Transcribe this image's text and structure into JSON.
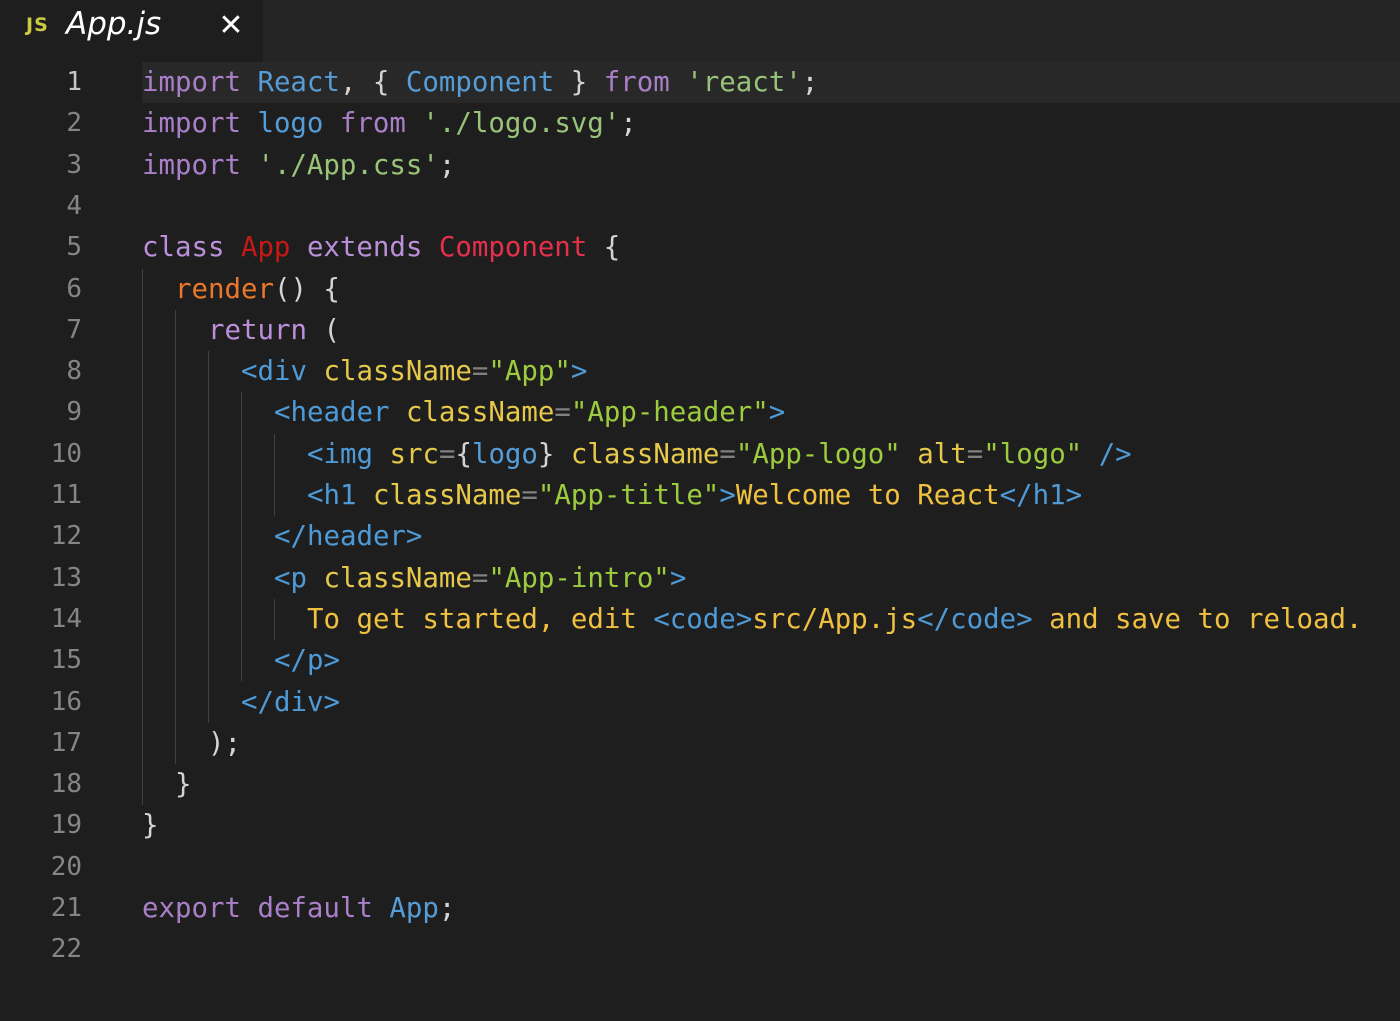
{
  "tab": {
    "icon_label": "JS",
    "icon": "js-file-icon",
    "title": "App.js",
    "close": "✕"
  },
  "editor": {
    "active_line": 1,
    "lines": [
      {
        "n": "1",
        "indent": 0,
        "tokens": [
          [
            "imp",
            "import"
          ],
          [
            "pun",
            " "
          ],
          [
            "id",
            "React"
          ],
          [
            "pun",
            ", { "
          ],
          [
            "id",
            "Component"
          ],
          [
            "pun",
            " } "
          ],
          [
            "imp",
            "from"
          ],
          [
            "pun",
            " "
          ],
          [
            "str",
            "'react'"
          ],
          [
            "pun",
            ";"
          ]
        ]
      },
      {
        "n": "2",
        "indent": 0,
        "tokens": [
          [
            "imp",
            "import"
          ],
          [
            "pun",
            " "
          ],
          [
            "id",
            "logo"
          ],
          [
            "pun",
            " "
          ],
          [
            "imp",
            "from"
          ],
          [
            "pun",
            " "
          ],
          [
            "str",
            "'./logo.svg'"
          ],
          [
            "pun",
            ";"
          ]
        ]
      },
      {
        "n": "3",
        "indent": 0,
        "tokens": [
          [
            "imp",
            "import"
          ],
          [
            "pun",
            " "
          ],
          [
            "str",
            "'./App.css'"
          ],
          [
            "pun",
            ";"
          ]
        ]
      },
      {
        "n": "4",
        "indent": 0,
        "tokens": []
      },
      {
        "n": "5",
        "indent": 0,
        "tokens": [
          [
            "cls",
            "class"
          ],
          [
            "pun",
            " "
          ],
          [
            "red",
            "App"
          ],
          [
            "pun",
            " "
          ],
          [
            "cls",
            "extends"
          ],
          [
            "pun",
            " "
          ],
          [
            "comp",
            "Component"
          ],
          [
            "pun",
            " {"
          ]
        ]
      },
      {
        "n": "6",
        "indent": 1,
        "tokens": [
          [
            "fn",
            "render"
          ],
          [
            "pun",
            "() {"
          ]
        ]
      },
      {
        "n": "7",
        "indent": 2,
        "tokens": [
          [
            "cls",
            "return"
          ],
          [
            "pun",
            " ("
          ]
        ]
      },
      {
        "n": "8",
        "indent": 3,
        "tokens": [
          [
            "tag",
            "<div"
          ],
          [
            "pun",
            " "
          ],
          [
            "attr",
            "className"
          ],
          [
            "eq",
            "="
          ],
          [
            "aval",
            "\"App\""
          ],
          [
            "tag",
            ">"
          ]
        ]
      },
      {
        "n": "9",
        "indent": 4,
        "tokens": [
          [
            "tag",
            "<header"
          ],
          [
            "pun",
            " "
          ],
          [
            "attr",
            "className"
          ],
          [
            "eq",
            "="
          ],
          [
            "aval",
            "\"App-header\""
          ],
          [
            "tag",
            ">"
          ]
        ]
      },
      {
        "n": "10",
        "indent": 5,
        "tokens": [
          [
            "tag",
            "<img"
          ],
          [
            "pun",
            " "
          ],
          [
            "attr",
            "src"
          ],
          [
            "eq",
            "="
          ],
          [
            "pun",
            "{"
          ],
          [
            "id",
            "logo"
          ],
          [
            "pun",
            "}"
          ],
          [
            "pun",
            " "
          ],
          [
            "attr",
            "className"
          ],
          [
            "eq",
            "="
          ],
          [
            "aval",
            "\"App-logo\""
          ],
          [
            "pun",
            " "
          ],
          [
            "attr",
            "alt"
          ],
          [
            "eq",
            "="
          ],
          [
            "aval",
            "\"logo\""
          ],
          [
            "pun",
            " "
          ],
          [
            "tag",
            "/>"
          ]
        ]
      },
      {
        "n": "11",
        "indent": 5,
        "tokens": [
          [
            "tag",
            "<h1"
          ],
          [
            "pun",
            " "
          ],
          [
            "attr",
            "className"
          ],
          [
            "eq",
            "="
          ],
          [
            "aval",
            "\"App-title\""
          ],
          [
            "tag",
            ">"
          ],
          [
            "txt",
            "Welcome to React"
          ],
          [
            "tag",
            "</h1>"
          ]
        ]
      },
      {
        "n": "12",
        "indent": 4,
        "tokens": [
          [
            "tag",
            "</header>"
          ]
        ]
      },
      {
        "n": "13",
        "indent": 4,
        "tokens": [
          [
            "tag",
            "<p"
          ],
          [
            "pun",
            " "
          ],
          [
            "attr",
            "className"
          ],
          [
            "eq",
            "="
          ],
          [
            "aval",
            "\"App-intro\""
          ],
          [
            "tag",
            ">"
          ]
        ]
      },
      {
        "n": "14",
        "indent": 5,
        "tokens": [
          [
            "txt",
            "To get started, edit "
          ],
          [
            "tag",
            "<code>"
          ],
          [
            "txt",
            "src/App.js"
          ],
          [
            "tag",
            "</code>"
          ],
          [
            "txt",
            " and save to reload."
          ]
        ]
      },
      {
        "n": "15",
        "indent": 4,
        "tokens": [
          [
            "tag",
            "</p>"
          ]
        ]
      },
      {
        "n": "16",
        "indent": 3,
        "tokens": [
          [
            "tag",
            "</div>"
          ]
        ]
      },
      {
        "n": "17",
        "indent": 2,
        "tokens": [
          [
            "pun",
            ");"
          ]
        ]
      },
      {
        "n": "18",
        "indent": 1,
        "tokens": [
          [
            "pun",
            "}"
          ]
        ]
      },
      {
        "n": "19",
        "indent": 0,
        "tokens": [
          [
            "pun",
            "}"
          ]
        ]
      },
      {
        "n": "20",
        "indent": 0,
        "tokens": []
      },
      {
        "n": "21",
        "indent": 0,
        "tokens": [
          [
            "imp",
            "export"
          ],
          [
            "pun",
            " "
          ],
          [
            "imp",
            "default"
          ],
          [
            "pun",
            " "
          ],
          [
            "id",
            "App"
          ],
          [
            "pun",
            ";"
          ]
        ]
      },
      {
        "n": "22",
        "indent": 0,
        "tokens": []
      }
    ]
  },
  "colors": {
    "background": "#1e1e1e",
    "tabbar": "#252526",
    "line_number": "#858585",
    "keyword": "#c586c0",
    "identifier": "#569cd6",
    "string": "#98c379",
    "jsx_tag": "#4e9ad6",
    "jsx_attr": "#e6c84a",
    "jsx_text": "#f0c040"
  }
}
